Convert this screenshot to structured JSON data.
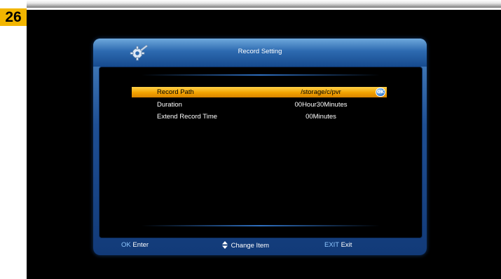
{
  "badge": "26",
  "window": {
    "title": "Record Setting",
    "icon": "gear-icon"
  },
  "settings": [
    {
      "label": "Record Path",
      "value": "/storage/c/pvr",
      "selected": true
    },
    {
      "label": "Duration",
      "value": "00Hour30Minutes",
      "selected": false
    },
    {
      "label": "Extend Record Time",
      "value": "00Minutes",
      "selected": false
    }
  ],
  "ok_icon": {
    "icon": "ok-button-icon",
    "text": "OK"
  },
  "footer": {
    "enter_key": "OK",
    "enter_label": "Enter",
    "change_icon": "up-down-arrow-icon",
    "change_label": "Change Item",
    "exit_key": "EXIT",
    "exit_label": "Exit"
  },
  "colors": {
    "selected_bar": "#f2a200",
    "frame_blue": "#1e4f94",
    "background": "#000000",
    "key_blue": "#8fc7ff"
  }
}
